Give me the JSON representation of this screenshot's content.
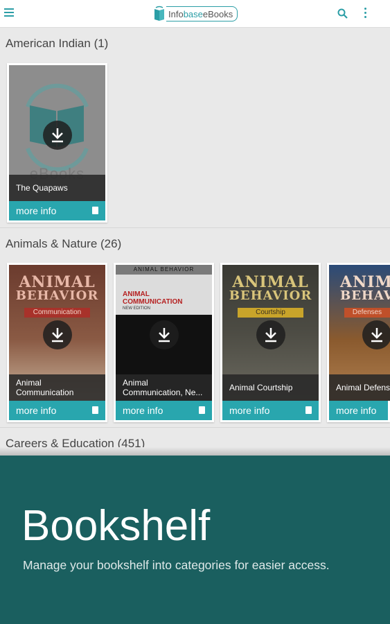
{
  "app": {
    "logo_prefix": "Info",
    "logo_suffix": "base",
    "logo_end": "eBooks",
    "icons": [
      "hamburger-menu-icon",
      "search-icon",
      "more-vert-icon"
    ]
  },
  "colors": {
    "accent": "#29a6ae",
    "promo_bg": "#1a5f5f"
  },
  "sections": [
    {
      "title": "American Indian (1)",
      "books": [
        {
          "title": "The Quapaws",
          "action": "more info",
          "placeholder_text": "eBooks"
        }
      ]
    },
    {
      "title": "Animals & Nature (26)",
      "books": [
        {
          "title": "Animal Communication",
          "action": "more info",
          "cover_title": "ANIMAL",
          "cover_title2": "BEHAVIOR",
          "cover_subtitle": "Communication"
        },
        {
          "title": "Animal Communication, Ne...",
          "action": "more info",
          "cover_series": "ANIMAL BEHAVIOR",
          "cover_title": "ANIMAL",
          "cover_title2": "COMMUNICATION",
          "cover_edition": "NEW EDITION"
        },
        {
          "title": "Animal Courtship",
          "action": "more info",
          "cover_title": "ANIMAL",
          "cover_title2": "BEHAVIOR",
          "cover_subtitle": "Courtship"
        },
        {
          "title": "Animal Defense",
          "action": "more info",
          "cover_title": "ANIMAL",
          "cover_title2": "BEHAVIOR",
          "cover_subtitle": "Defenses"
        }
      ]
    },
    {
      "title": "Careers & Education (451)",
      "books": []
    }
  ],
  "promo": {
    "headline": "Bookshelf",
    "subtitle": "Manage your bookshelf into categories for easier access."
  }
}
